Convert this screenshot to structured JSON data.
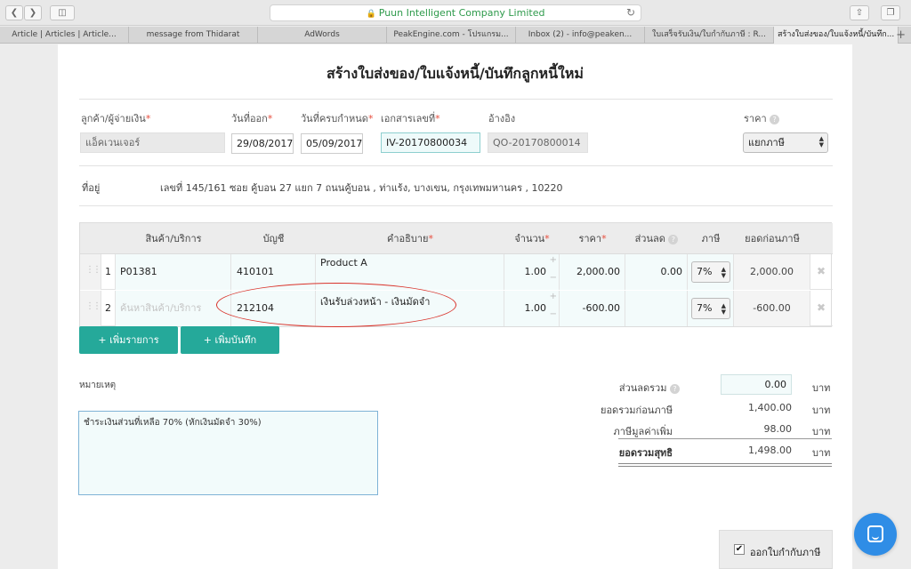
{
  "browser": {
    "url_title": "Puun Intelligent Company Limited",
    "tabs": [
      "Article | Articles | Article...",
      "message from Thidarat",
      "AdWords",
      "PeakEngine.com - โปรแกรม...",
      "Inbox (2) - info@peaken...",
      "ใบเสร็จรับเงิน/ใบกำกับภาษี : R...",
      "สร้างใบส่งของ/ใบแจ้งหนี้/บันทึก..."
    ],
    "new_tab": "+"
  },
  "form": {
    "title": "สร้างใบส่งของ/ใบแจ้งหนี้/บันทึกลูกหนี้ใหม่",
    "customer_label": "ลูกค้า/ผู้จ่ายเงิน",
    "customer_value": "แอ็คเวนเจอร์",
    "issue_date_label": "วันที่ออก",
    "issue_date": "29/08/2017",
    "due_date_label": "วันที่ครบกำหนด",
    "due_date": "05/09/2017",
    "doc_no_label": "เอกสารเลขที่",
    "doc_no": "IV-20170800034",
    "reference_label": "อ้างอิง",
    "reference": "QO-20170800014",
    "price_label": "ราคา",
    "price_type": "แยกภาษี",
    "address_label": "ที่อยู่",
    "address": "เลขที่ 145/161 ซอย คู้บอน 27 แยก 7 ถนนคู้บอน , ท่าแร้ง, บางเขน, กรุงเทพมหานคร , 10220",
    "required_mark": "*",
    "help_mark": "?"
  },
  "table": {
    "headers": {
      "product": "สินค้า/บริการ",
      "account": "บัญชี",
      "description": "คำอธิบาย",
      "qty": "จำนวน",
      "price": "ราคา",
      "discount": "ส่วนลด",
      "vat": "ภาษี",
      "pretax": "ยอดก่อนภาษี"
    },
    "rows": [
      {
        "no": "1",
        "product": "P01381",
        "product_placeholder": "",
        "account": "410101",
        "description": "Product A",
        "qty": "1.00",
        "price": "2,000.00",
        "discount": "0.00",
        "vat": "7%",
        "pretax": "2,000.00"
      },
      {
        "no": "2",
        "product": "",
        "product_placeholder": "ค้นหาสินค้า/บริการ",
        "account": "212104",
        "description": "เงินรับล่วงหน้า - เงินมัดจำ",
        "qty": "1.00",
        "price": "-600.00",
        "discount": "",
        "vat": "7%",
        "pretax": "-600.00"
      }
    ],
    "add_item_label": "+ เพิ่มรายการ",
    "add_note_label": "+ เพิ่มบันทึก"
  },
  "notes": {
    "label": "หมายเหตุ",
    "text": "ชำระเงินส่วนที่เหลือ 70% (หักเงินมัดจำ 30%)"
  },
  "summary": {
    "total_discount_label": "ส่วนลดรวม",
    "total_discount": "0.00",
    "subtotal_label": "ยอดรวมก่อนภาษี",
    "subtotal": "1,400.00",
    "vat_label": "ภาษีมูลค่าเพิ่ม",
    "vat": "98.00",
    "net_label": "ยอดรวมสุทธิ",
    "net": "1,498.00",
    "currency": "บาท"
  },
  "tax_invoice": {
    "checkbox_label": "ออกใบกำกับภาษี",
    "checked": true
  }
}
